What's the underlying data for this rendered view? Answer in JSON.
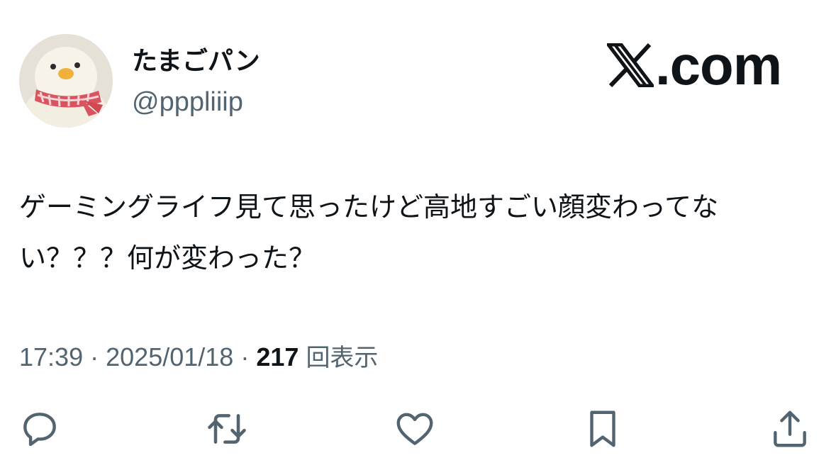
{
  "user": {
    "display_name": "たまごパン",
    "handle": "@pppliiip",
    "avatar_icon": "duck-plush-avatar"
  },
  "brand": {
    "logo_icon": "x-logo-icon",
    "logo_text": ".com"
  },
  "tweet": {
    "text": "ゲーミングライフ見て思ったけど高地すごい顔変わってない？？？何が変わった？"
  },
  "meta": {
    "time": "17:39",
    "separator": "·",
    "date": "2025/01/18",
    "views_count": "217",
    "views_label": "回表示"
  },
  "actions": [
    {
      "icon": "reply-icon"
    },
    {
      "icon": "retweet-icon"
    },
    {
      "icon": "like-icon"
    },
    {
      "icon": "bookmark-icon"
    },
    {
      "icon": "share-icon"
    }
  ],
  "colors": {
    "text_primary": "#0f1419",
    "text_secondary": "#536471",
    "background": "#ffffff"
  }
}
